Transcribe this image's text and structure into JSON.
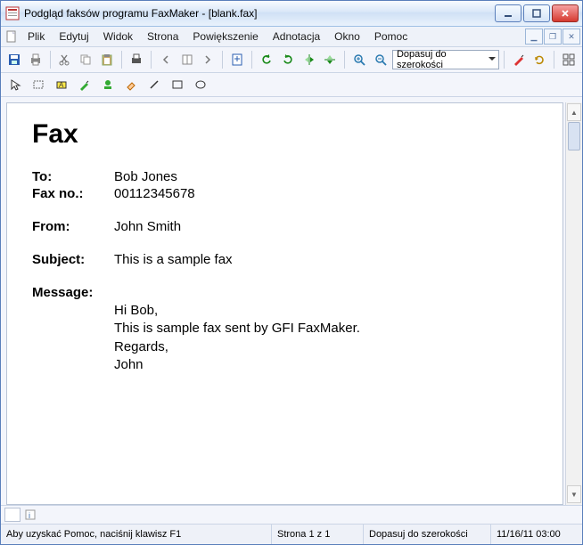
{
  "title": "Podgląd faksów programu FaxMaker - [blank.fax]",
  "menu": {
    "file": "Plik",
    "edit": "Edytuj",
    "view": "Widok",
    "page": "Strona",
    "zoom": "Powiększenie",
    "annotation": "Adnotacja",
    "window": "Okno",
    "help": "Pomoc"
  },
  "zoom_select": "Dopasuj do szerokości",
  "fax": {
    "heading": "Fax",
    "to_label": "To:",
    "to_value": "Bob Jones",
    "faxno_label": "Fax no.:",
    "faxno_value": "00112345678",
    "from_label": "From:",
    "from_value": "John Smith",
    "subject_label": "Subject:",
    "subject_value": "This is a sample fax",
    "message_label": "Message:",
    "message_lines": [
      "Hi Bob,",
      "This is sample fax sent by GFI FaxMaker.",
      "Regards,",
      "John"
    ]
  },
  "status": {
    "help": "Aby uzyskać Pomoc, naciśnij klawisz F1",
    "page": "Strona 1 z 1",
    "zoom": "Dopasuj do szerokości",
    "datetime": "11/16/11 03:00"
  }
}
